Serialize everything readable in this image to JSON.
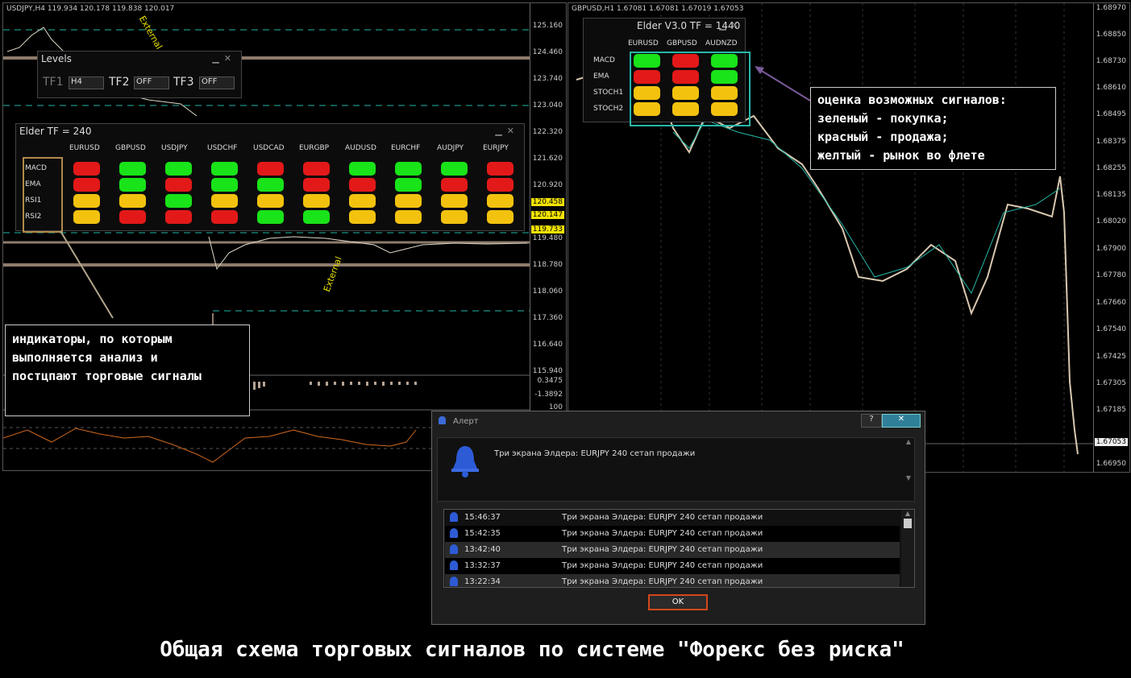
{
  "left_chart": {
    "header": "USDJPY,H4  119.934 120.178 119.838 120.017",
    "price_ticks": [
      "125.160",
      "124.460",
      "123.740",
      "123.040",
      "122.320",
      "121.620",
      "120.920",
      "120.458",
      "120.147",
      "119.733",
      "119.480",
      "118.780",
      "118.060",
      "117.360",
      "116.640",
      "115.940"
    ],
    "price_boxes": [
      "120.458",
      "120.147",
      "119.733"
    ],
    "indicator_ticks": [
      "0.3475",
      "-1.3892",
      "100"
    ],
    "labels": [
      "External",
      "External"
    ]
  },
  "levels_panel": {
    "title": "Levels",
    "tf1_label": "TF1",
    "tf1_value": "H4",
    "tf2_label": "TF2",
    "tf2_value": "OFF",
    "tf3_label": "TF3",
    "tf3_value": "OFF"
  },
  "elder_left": {
    "title": "Elder TF = 240",
    "columns": [
      "EURUSD",
      "GBPUSD",
      "USDJPY",
      "USDCHF",
      "USDCAD",
      "EURGBP",
      "AUDUSD",
      "EURCHF",
      "AUDJPY",
      "EURJPY"
    ],
    "rows": [
      "MACD",
      "EMA",
      "RSI1",
      "RSI2"
    ],
    "signals": [
      [
        "r",
        "g",
        "g",
        "g",
        "r",
        "r",
        "g",
        "g",
        "g",
        "r"
      ],
      [
        "r",
        "g",
        "r",
        "g",
        "g",
        "r",
        "r",
        "g",
        "r",
        "r"
      ],
      [
        "y",
        "y",
        "g",
        "y",
        "y",
        "y",
        "y",
        "y",
        "y",
        "y"
      ],
      [
        "y",
        "r",
        "r",
        "r",
        "g",
        "g",
        "y",
        "y",
        "y",
        "y"
      ]
    ]
  },
  "right_chart": {
    "header": "GBPUSD,H1  1.67081 1.67081 1.67019 1.67053",
    "price_ticks": [
      "1.68970",
      "1.68850",
      "1.68730",
      "1.68610",
      "1.68495",
      "1.68375",
      "1.68255",
      "1.68135",
      "1.68020",
      "1.67900",
      "1.67780",
      "1.67660",
      "1.67540",
      "1.67425",
      "1.67305",
      "1.67185",
      "1.67053",
      "1.66950"
    ],
    "current_price": "1.67053"
  },
  "elder_right": {
    "title": "Elder V3.0 TF = 1440",
    "columns": [
      "EURUSD",
      "GBPUSD",
      "AUDNZD"
    ],
    "rows": [
      "MACD",
      "EMA",
      "STOCH1",
      "STOCH2"
    ],
    "signals": [
      [
        "g",
        "r",
        "g"
      ],
      [
        "r",
        "r",
        "g"
      ],
      [
        "y",
        "y",
        "y"
      ],
      [
        "y",
        "y",
        "y"
      ]
    ]
  },
  "callout_right": {
    "lines": [
      "оценка возможных сигналов:",
      "зеленый - покупка;",
      "красный - продажа;",
      "желтый - рынок во флете"
    ]
  },
  "callout_left": {
    "lines": [
      "индикаторы, по которым",
      "выполняется анализ и",
      "постцпают торговые сигналы"
    ]
  },
  "alert": {
    "title": "Алерт",
    "help": "?",
    "close": "✕",
    "main_message": "Три экрана Элдера: EURJPY  240 сетап продажи",
    "log": [
      {
        "time": "15:46:37",
        "text": "Три экрана Элдера: EURJPY  240 сетап продажи"
      },
      {
        "time": "15:42:35",
        "text": "Три экрана Элдера: EURJPY  240 сетап продажи"
      },
      {
        "time": "13:42:40",
        "text": "Три экрана Элдера: EURJPY  240 сетап продажи"
      },
      {
        "time": "13:32:37",
        "text": "Три экрана Элдера: EURJPY  240 сетап продажи"
      },
      {
        "time": "13:22:34",
        "text": "Три экрана Элдера: EURJPY  240 сетап продажи"
      }
    ],
    "ok_label": "OK"
  },
  "caption": "Общая схема торговых сигналов по системе \"Форекс без риска\"",
  "colors": {
    "green": "#19e319",
    "red": "#e31919",
    "yellow": "#f2c20e",
    "ok_border": "#d2481b",
    "cyan": "#25b8a8"
  }
}
